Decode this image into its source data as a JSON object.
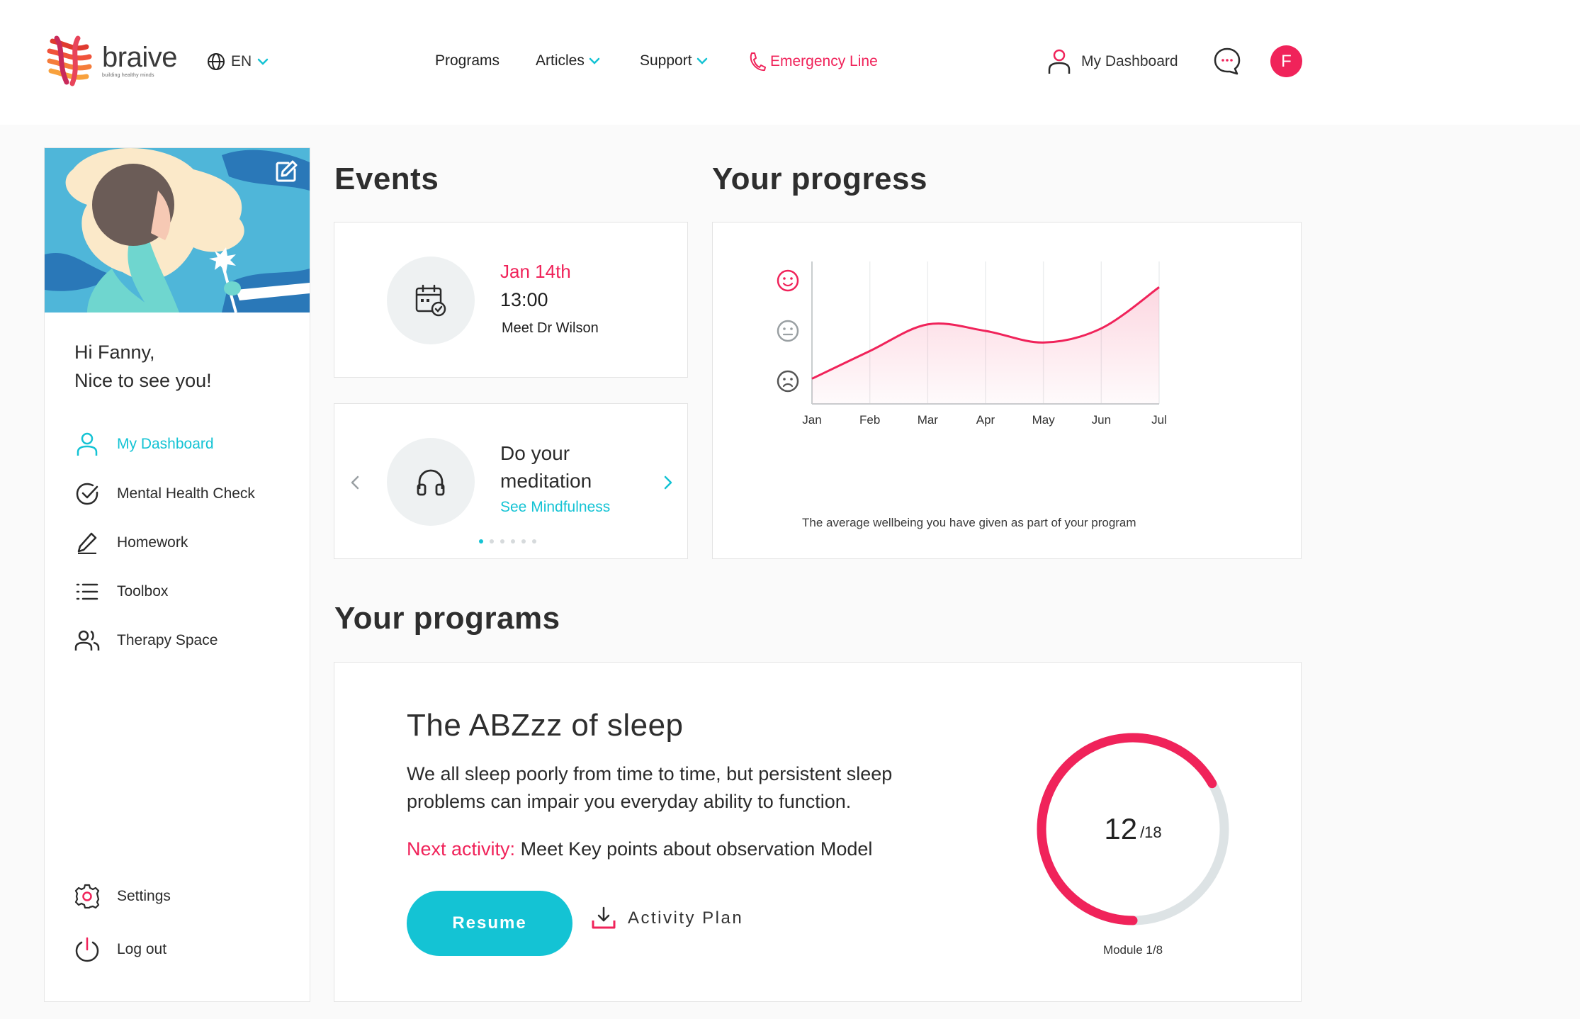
{
  "brand": {
    "name": "braive",
    "tagline": "building healthy minds"
  },
  "header": {
    "language": "EN",
    "nav": [
      {
        "label": "Programs"
      },
      {
        "label": "Articles"
      },
      {
        "label": "Support"
      },
      {
        "label": "Emergency Line"
      }
    ],
    "dashboard_label": "My Dashboard",
    "avatar_initial": "F"
  },
  "sidebar": {
    "greeting_line1": "Hi Fanny,",
    "greeting_line2": "Nice to see you!",
    "menu": [
      {
        "label": "My Dashboard",
        "icon": "user-icon",
        "active": true
      },
      {
        "label": "Mental Health Check",
        "icon": "check-circle-icon"
      },
      {
        "label": "Homework",
        "icon": "pencil-icon"
      },
      {
        "label": "Toolbox",
        "icon": "list-icon"
      },
      {
        "label": "Therapy Space",
        "icon": "users-icon"
      }
    ],
    "bottom_menu": [
      {
        "label": "Settings",
        "icon": "gear-icon"
      },
      {
        "label": "Log out",
        "icon": "power-icon"
      }
    ]
  },
  "events": {
    "title": "Events",
    "event": {
      "date": "Jan 14th",
      "time": "13:00",
      "description": "Meet Dr Wilson"
    },
    "carousel": {
      "title": "Do your meditation",
      "link": "See Mindfulness",
      "dots": 6,
      "active_dot": 0
    }
  },
  "progress": {
    "title": "Your progress",
    "caption": "The average wellbeing you have given as part of your program"
  },
  "chart_data": {
    "type": "area",
    "title": "Your progress",
    "x": [
      "Jan",
      "Feb",
      "Mar",
      "Apr",
      "May",
      "Jun",
      "Jul"
    ],
    "y_levels": [
      "sad",
      "neutral",
      "happy"
    ],
    "ylim": [
      1,
      3
    ],
    "series": [
      {
        "values": [
          1.05,
          1.6,
          2.13,
          2.0,
          1.77,
          2.05,
          2.87
        ]
      }
    ],
    "grid": true,
    "colors": {
      "line": "#f0235a",
      "fill": "#fde6ee",
      "happy": "#f0235a",
      "neutral": "#9aa0a3",
      "sad": "#555555"
    }
  },
  "programs": {
    "title": "Your programs",
    "program": {
      "name": "The ABZzz of sleep",
      "description": "We all sleep poorly from time to time, but persistent sleep problems can impair you everyday ability to function.",
      "next_label": "Next activity:",
      "next_value": "Meet Key points about observation Model",
      "resume_label": "Resume",
      "plan_label": "Activity Plan",
      "completed": 12,
      "total_label": "/18",
      "total": 18,
      "module_label": "Module 1/8"
    }
  },
  "colors": {
    "accent": "#14c3d4",
    "brand": "#f0235a"
  }
}
